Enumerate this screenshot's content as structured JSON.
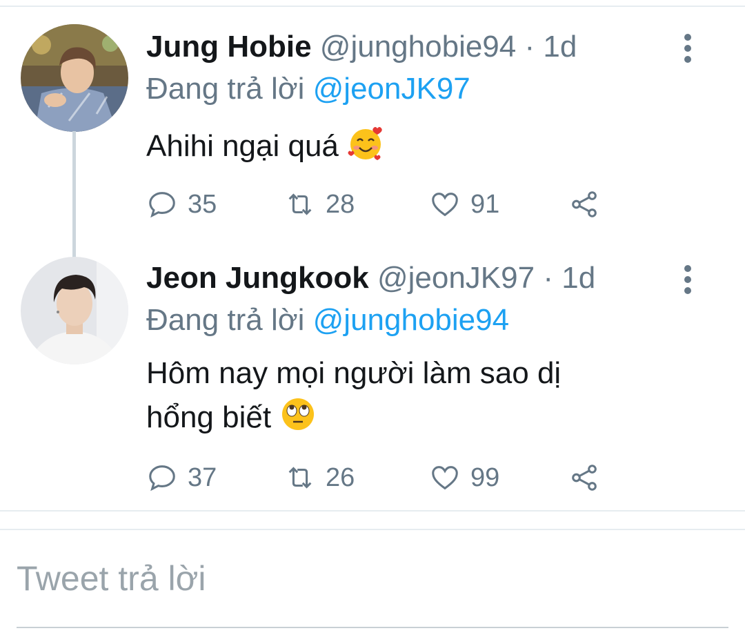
{
  "tweets": [
    {
      "name": "Jung Hobie",
      "handle": "@junghobie94",
      "separator": "·",
      "time": "1d",
      "reply_prefix": "Đang trả lời",
      "reply_to": "@jeonJK97",
      "text": "Ahihi ngại quá",
      "emoji": "smiling-face-with-hearts",
      "replies": "35",
      "retweets": "28",
      "likes": "91"
    },
    {
      "name": "Jeon Jungkook",
      "handle": "@jeonJK97",
      "separator": "·",
      "time": "1d",
      "reply_prefix": "Đang trả lời",
      "reply_to": "@junghobie94",
      "text_line1": "Hôm nay mọi người làm sao dị",
      "text_line2": "hổng biết",
      "emoji": "face-with-rolling-eyes",
      "replies": "37",
      "retweets": "26",
      "likes": "99"
    }
  ],
  "compose": {
    "placeholder": "Tweet trả lời"
  },
  "colors": {
    "link": "#1da1f2",
    "secondary_text": "#657786",
    "divider": "#e6ecf0"
  }
}
